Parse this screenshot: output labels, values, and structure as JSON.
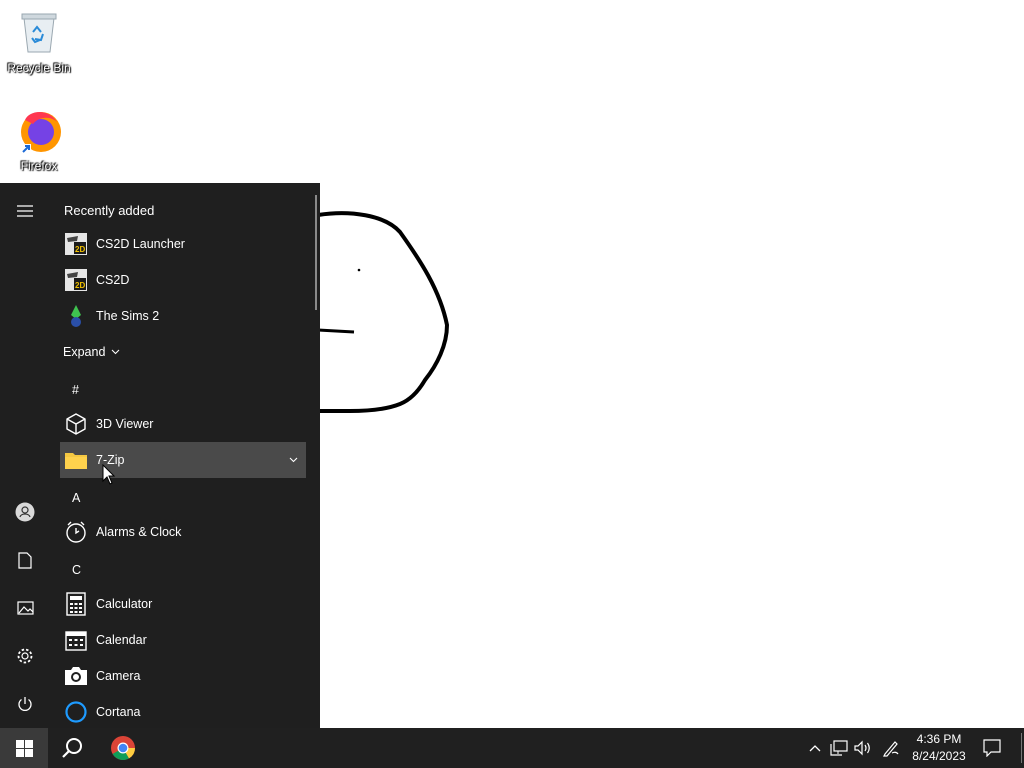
{
  "desktop": {
    "icons": [
      {
        "label": "Recycle Bin",
        "icon": "recycle-bin-icon"
      },
      {
        "label": "Firefox",
        "icon": "firefox-icon"
      }
    ]
  },
  "start_menu": {
    "recently_added_title": "Recently added",
    "recent_apps": [
      {
        "label": "CS2D Launcher",
        "icon": "cs2d-icon"
      },
      {
        "label": "CS2D",
        "icon": "cs2d-icon"
      },
      {
        "label": "The Sims 2",
        "icon": "sims-icon"
      }
    ],
    "expand_label": "Expand",
    "groups": [
      {
        "letter": "#",
        "apps": [
          {
            "label": "3D Viewer",
            "icon": "cube-icon"
          },
          {
            "label": "7-Zip",
            "icon": "folder-icon",
            "selected": true
          }
        ]
      },
      {
        "letter": "A",
        "apps": [
          {
            "label": "Alarms & Clock",
            "icon": "clock-icon"
          }
        ]
      },
      {
        "letter": "C",
        "apps": [
          {
            "label": "Calculator",
            "icon": "calculator-icon"
          },
          {
            "label": "Calendar",
            "icon": "calendar-icon"
          },
          {
            "label": "Camera",
            "icon": "camera-icon"
          },
          {
            "label": "Cortana",
            "icon": "cortana-icon"
          }
        ]
      }
    ],
    "rail": [
      "hamburger-icon",
      "user-icon",
      "documents-icon",
      "pictures-icon",
      "settings-icon",
      "power-icon"
    ]
  },
  "taskbar": {
    "pinned": [
      "start-icon",
      "search-icon",
      "chrome-icon"
    ],
    "tray": [
      "chevron-up-icon",
      "network-icon",
      "volume-icon",
      "pen-icon",
      "notification-icon"
    ],
    "time": "4:36 PM",
    "date": "8/24/2023"
  },
  "colors": {
    "menu_bg": "#1f1f1f",
    "taskbar_bg": "#202020",
    "selected_row": "#4a4a4a"
  }
}
